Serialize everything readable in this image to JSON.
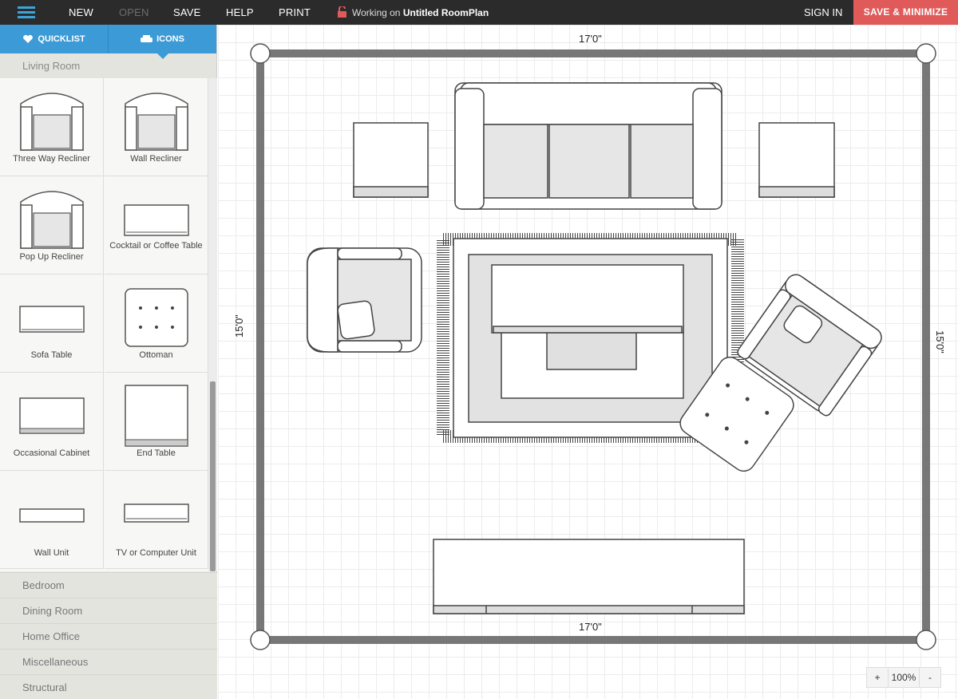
{
  "topbar": {
    "menu": [
      "NEW",
      "OPEN",
      "SAVE",
      "HELP",
      "PRINT"
    ],
    "status_prefix": "Working on",
    "plan_name": "Untitled RoomPlan",
    "signin": "SIGN IN",
    "save_minimize": "SAVE & MINIMIZE",
    "colors": {
      "bar": "#2b2b2b",
      "accent": "#3da3d9",
      "save": "#e05a5a"
    }
  },
  "sidebar": {
    "tabs": [
      {
        "label": "QUICKLIST",
        "icon": "heart-icon"
      },
      {
        "label": "ICONS",
        "icon": "sofa-icon"
      }
    ],
    "open_category": "Living Room",
    "items": [
      {
        "label": "Three Way Recliner",
        "icon": "recliner-icon"
      },
      {
        "label": "Wall Recliner",
        "icon": "recliner-icon"
      },
      {
        "label": "Pop Up Recliner",
        "icon": "recliner-icon"
      },
      {
        "label": "Cocktail or Coffee Table",
        "icon": "coffee-table-icon"
      },
      {
        "label": "Sofa Table",
        "icon": "sofa-table-icon"
      },
      {
        "label": "Ottoman",
        "icon": "ottoman-icon"
      },
      {
        "label": "Occasional Cabinet",
        "icon": "cabinet-icon"
      },
      {
        "label": "End Table",
        "icon": "end-table-icon"
      },
      {
        "label": "Wall Unit",
        "icon": "wall-unit-icon"
      },
      {
        "label": "TV or Computer Unit",
        "icon": "tv-unit-icon"
      }
    ],
    "categories": [
      "Bedroom",
      "Dining Room",
      "Home Office",
      "Miscellaneous",
      "Structural"
    ]
  },
  "canvas": {
    "top_dim": "17'0\"",
    "bottom_dim": "17'0\"",
    "left_dim": "15'0\"",
    "right_dim": "15'0\"",
    "zoom": {
      "minus": "-",
      "plus": "+",
      "value": "100%"
    }
  }
}
